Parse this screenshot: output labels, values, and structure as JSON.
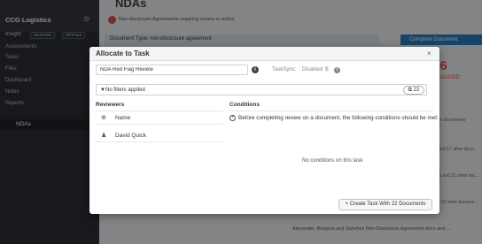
{
  "app": {
    "brand": "CCG Logistics",
    "sidebar_label": "Insight",
    "chip_manage": "MANAGE",
    "chip_details": "DETAILS",
    "sidebar_items": [
      "Assessments",
      "Tasks",
      "Files",
      "Dashboard",
      "Notes",
      "Reports"
    ],
    "sidebar_active": "NDAs",
    "page_title": "NDAs",
    "page_subtitle": "Non-disclosure Agreements requiring review or action",
    "filter_text": "Document Type: non-disclosure agreement",
    "complete_label": "Complete Document",
    "stat_value": "46",
    "stat_label": "FLAGGED",
    "right_texts": [
      "other documents",
      "ks and 17 other docu...",
      "ksks and 31 other doc...",
      "and 23 other docume..."
    ],
    "bottom_text": "Alexander, Burgess and Sanchez Non-Disclosure Agreement.docx and ..."
  },
  "modal": {
    "title": "Allocate to Task",
    "close_label": "×",
    "task_name": "NDA Red Flag Review",
    "tasksync_label": "TaskSync:",
    "tasksync_value": "Disabled",
    "dollar": "$",
    "filters_text": "No filters applied",
    "doc_count": "22",
    "reviewers_heading": "Reviewers",
    "reviewers_name_header": "Name",
    "reviewer_1": "David Quick",
    "conditions_heading": "Conditions",
    "conditions_prompt": "Before completing review on a document, the following conditions should be met:",
    "no_conditions": "No conditions on this task",
    "create_button": "+ Create Task With 22 Documents"
  },
  "colors": {
    "accent": "#2a7ec1",
    "flag": "#e0524b",
    "sidebar": "#2b2f36"
  }
}
